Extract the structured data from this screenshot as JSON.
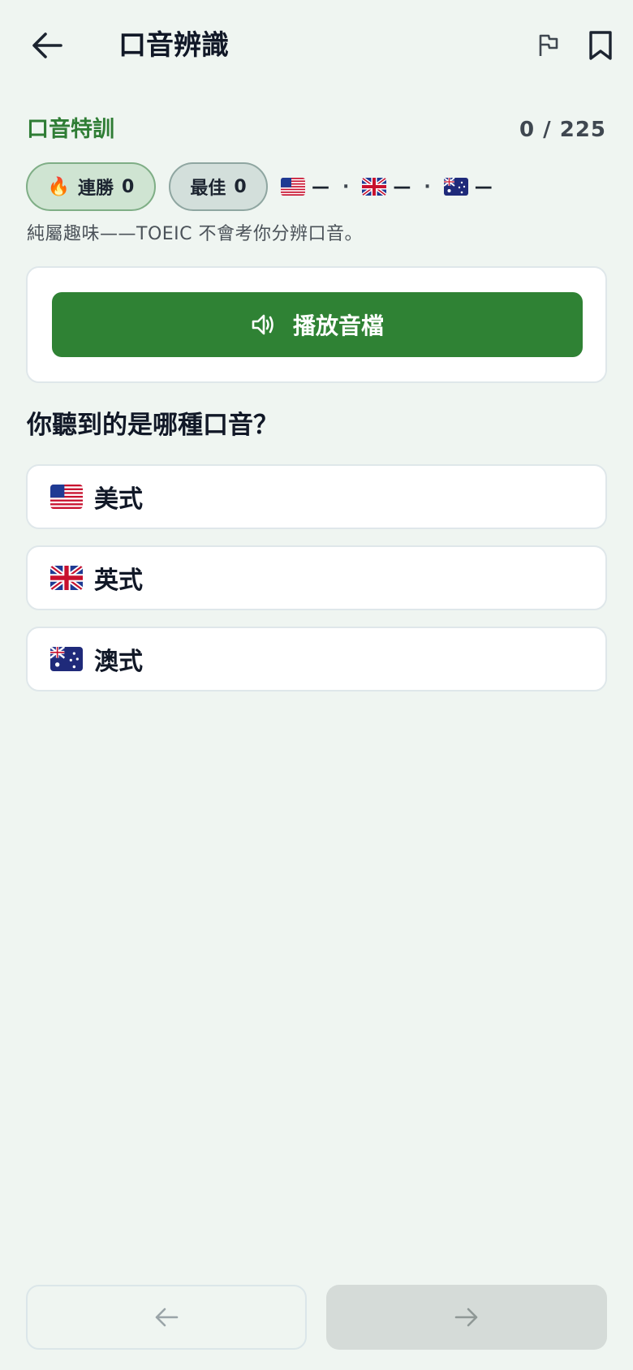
{
  "header": {
    "title": "口音辨識",
    "back_icon": "arrow-left-icon",
    "report_icon": "flag-icon",
    "bookmark_icon": "bookmark-icon"
  },
  "section": {
    "label": "口音特訓",
    "progress": "0 / 225"
  },
  "stats": {
    "streak_emoji": "🔥",
    "streak_label": "連勝",
    "streak_value": "0",
    "best_label": "最佳",
    "best_value": "0",
    "accents": [
      {
        "flag": "us-flag-icon",
        "value": "—"
      },
      {
        "flag": "uk-flag-icon",
        "value": "—"
      },
      {
        "flag": "au-flag-icon",
        "value": "—"
      }
    ],
    "separator": "·"
  },
  "note": "純屬趣味——TOEIC 不會考你分辨口音。",
  "play": {
    "label": "播放音檔",
    "icon": "speaker-icon"
  },
  "question": "你聽到的是哪種口音？",
  "options": [
    {
      "flag": "us-flag-icon",
      "label": "美式"
    },
    {
      "flag": "uk-flag-icon",
      "label": "英式"
    },
    {
      "flag": "au-flag-icon",
      "label": "澳式"
    }
  ],
  "nav": {
    "prev_icon": "arrow-left-icon",
    "next_icon": "arrow-right-icon"
  },
  "colors": {
    "accent_green": "#2f8234",
    "background": "#eff5f1"
  }
}
